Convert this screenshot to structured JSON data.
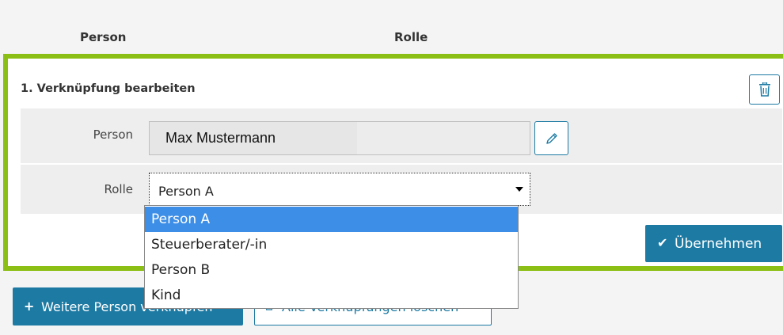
{
  "table_header": {
    "person_col": "Person",
    "rolle_col": "Rolle"
  },
  "edit_panel": {
    "title": "1. Verknüpfung bearbeiten",
    "delete_icon": "trash-icon",
    "person_label": "Person",
    "person_value": "Max Mustermann",
    "edit_icon": "pencil-icon",
    "rolle_label": "Rolle",
    "rolle_selected": "Person A",
    "apply_label": "Übernehmen",
    "apply_icon": "check-icon"
  },
  "dropdown": {
    "options": [
      "Person A",
      "Steuerberater/-in",
      "Person B",
      "Kind"
    ],
    "highlighted_index": 0
  },
  "actions": {
    "add_person_label": "Weitere Person verknüpfen",
    "delete_all_label": "Alle Verknüpfungen löschen"
  },
  "colors": {
    "accent": "#1d7aa3",
    "panel_border": "#8cbf15",
    "highlight": "#3d8ee6"
  }
}
